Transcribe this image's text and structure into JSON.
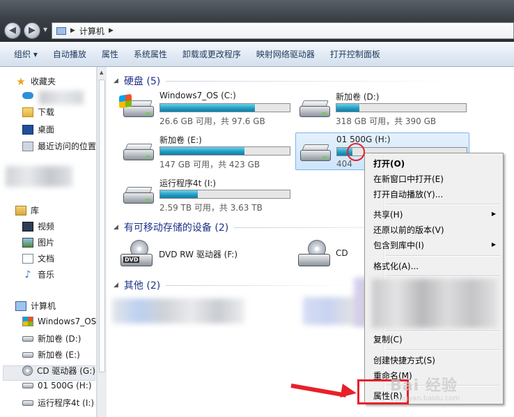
{
  "address": {
    "path": "计算机"
  },
  "toolbar": {
    "items": [
      "组织 ▾",
      "自动播放",
      "属性",
      "系统属性",
      "卸载或更改程序",
      "映射网络驱动器",
      "打开控制面板"
    ]
  },
  "sidebar": {
    "favorites_label": "收藏夹",
    "downloads": "下载",
    "desktop": "桌面",
    "recent": "最近访问的位置",
    "libraries_label": "库",
    "videos": "视频",
    "pictures": "图片",
    "documents": "文档",
    "music": "音乐",
    "computer_label": "计算机",
    "drives": [
      "Windows7_OS",
      "新加卷 (D:)",
      "新加卷 (E:)",
      "CD 驱动器 (G:)",
      "01 500G (H:)",
      "运行程序4t (I:)"
    ]
  },
  "groups": {
    "hard_disks": "硬盘 (5)",
    "removable": "有可移动存储的设备 (2)",
    "other": "其他 (2)"
  },
  "drives": [
    {
      "name": "Windows7_OS (C:)",
      "info": "26.6 GB 可用，共 97.6 GB",
      "used": 0.73
    },
    {
      "name": "新加卷 (D:)",
      "info": "318 GB 可用，共 390 GB",
      "used": 0.18
    },
    {
      "name": "新加卷 (E:)",
      "info": "147 GB 可用，共 423 GB",
      "used": 0.65
    },
    {
      "name": "01 500G (H:)",
      "info": "404",
      "used": 0.12
    },
    {
      "name": "运行程序4t (I:)",
      "info": "2.59 TB 可用，共 3.63 TB",
      "used": 0.29
    }
  ],
  "removable_drives": [
    {
      "name": "DVD RW 驱动器 (F:)"
    },
    {
      "name": "CD"
    }
  ],
  "context_menu": {
    "open": "打开(O)",
    "open_new_window": "在新窗口中打开(E)",
    "autoplay": "打开自动播放(Y)...",
    "share": "共享(H)",
    "restore": "还原以前的版本(V)",
    "include_library": "包含到库中(I)",
    "format": "格式化(A)...",
    "copy": "复制(C)",
    "create_shortcut": "创建快捷方式(S)",
    "rename": "重命名(M)",
    "properties": "属性(R)"
  },
  "watermark": {
    "main": "Bai 经验",
    "sub": "jingyan.baidu.com"
  },
  "colors": {
    "annotation": "#e8202a",
    "group_header": "#1e3287",
    "bar_fill": "#1d9ac3"
  }
}
